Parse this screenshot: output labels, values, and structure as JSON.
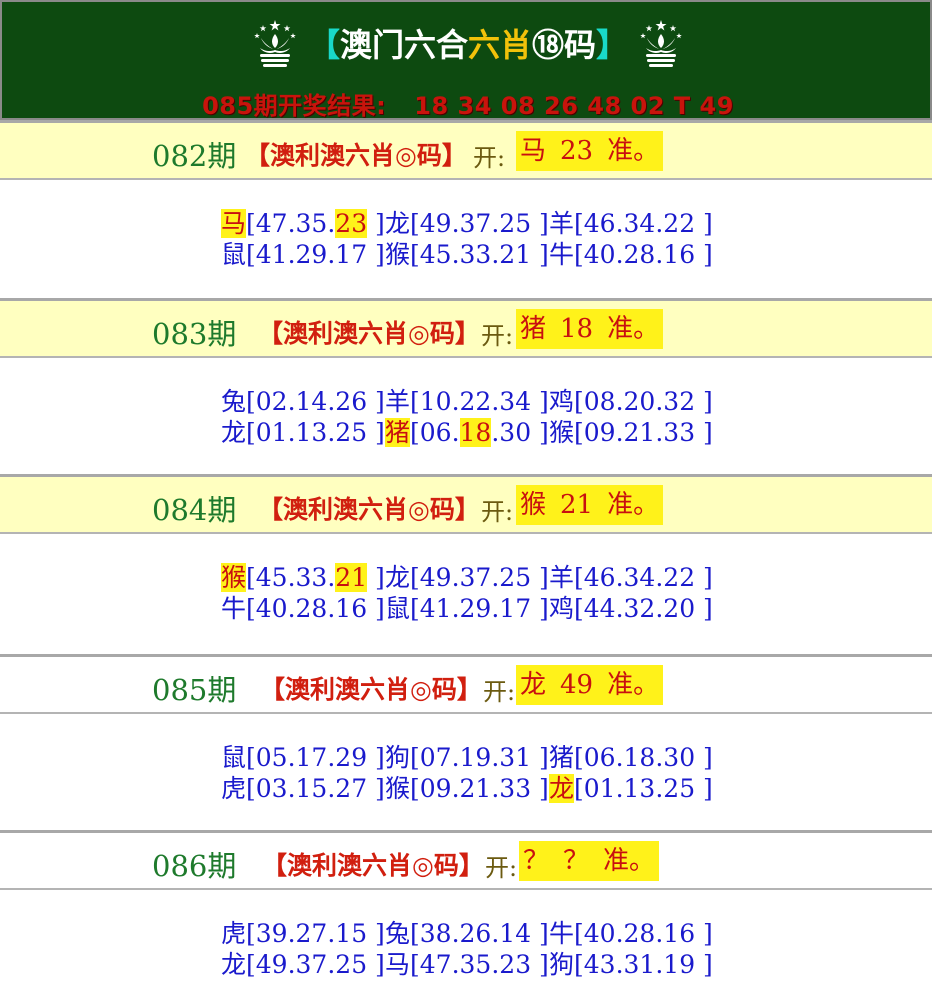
{
  "header": {
    "title_left_bracket": "【",
    "title_main": "澳门六合",
    "title_gold": "六肖",
    "title_circled": "⑱",
    "title_code": "码",
    "title_right_bracket": "】",
    "result_label": "085期开奖结果:",
    "result_numbers": "18 34 08 26 48 02 T 49"
  },
  "periods": [
    {
      "label": "082期",
      "title": "【澳利澳六肖◎码】",
      "open": "开:",
      "answer_zodiac": "马",
      "answer_number": "23",
      "answer_suffix": "准。",
      "rows": [
        [
          {
            "z": "马",
            "n1": "[47.35.",
            "hn": "23",
            "n2": " ]",
            "hz": true
          },
          {
            "z": "龙",
            "n1": "[49.37.25 ]"
          },
          {
            "z": "羊",
            "n1": "[46.34.22 ]"
          }
        ],
        [
          {
            "z": "鼠",
            "n1": "[41.29.17 ]"
          },
          {
            "z": "猴",
            "n1": "[45.33.21 ]"
          },
          {
            "z": "牛",
            "n1": "[40.28.16 ]"
          }
        ]
      ]
    },
    {
      "label": "083期",
      "title": "【澳利澳六肖◎码】",
      "open": "开:",
      "answer_zodiac": "猪",
      "answer_number": "18",
      "answer_suffix": "准。",
      "rows": [
        [
          {
            "z": "兔",
            "n1": "[02.14.26 ]"
          },
          {
            "z": "羊",
            "n1": "[10.22.34 ]"
          },
          {
            "z": "鸡",
            "n1": "[08.20.32 ]"
          }
        ],
        [
          {
            "z": "龙",
            "n1": "[01.13.25 ]"
          },
          {
            "z": "猪",
            "n1": "[06.",
            "hn": "18",
            "n2": ".30 ]",
            "hz": true
          },
          {
            "z": "猴",
            "n1": "[09.21.33 ]"
          }
        ]
      ]
    },
    {
      "label": "084期",
      "title": "【澳利澳六肖◎码】",
      "open": "开:",
      "answer_zodiac": "猴",
      "answer_number": "21",
      "answer_suffix": "准。",
      "rows": [
        [
          {
            "z": "猴",
            "n1": "[45.33.",
            "hn": "21",
            "n2": " ]",
            "hz": true
          },
          {
            "z": "龙",
            "n1": "[49.37.25 ]"
          },
          {
            "z": "羊",
            "n1": "[46.34.22 ]"
          }
        ],
        [
          {
            "z": "牛",
            "n1": "[40.28.16 ]"
          },
          {
            "z": "鼠",
            "n1": "[41.29.17 ]"
          },
          {
            "z": "鸡",
            "n1": "[44.32.20 ]"
          }
        ]
      ]
    },
    {
      "label": "085期",
      "title": "【澳利澳六肖◎码】",
      "open": "开:",
      "answer_zodiac": "龙",
      "answer_number": "49",
      "answer_suffix": "准。",
      "rows": [
        [
          {
            "z": "鼠",
            "n1": "[05.17.29 ]"
          },
          {
            "z": "狗",
            "n1": "[07.19.31 ]"
          },
          {
            "z": "猪",
            "n1": "[06.18.30 ]"
          }
        ],
        [
          {
            "z": "虎",
            "n1": "[03.15.27 ]"
          },
          {
            "z": "猴",
            "n1": "[09.21.33 ]"
          },
          {
            "z": "龙",
            "n1": "[01.13.25 ]",
            "hz": true
          }
        ]
      ]
    },
    {
      "label": "086期",
      "title": "【澳利澳六肖◎码】",
      "open": "开:",
      "answer_zodiac": "？",
      "answer_number": "？",
      "answer_suffix": "准。",
      "rows": [
        [
          {
            "z": "虎",
            "n1": "[39.27.15 ]"
          },
          {
            "z": "兔",
            "n1": "[38.26.14 ]"
          },
          {
            "z": "牛",
            "n1": "[40.28.16 ]"
          }
        ],
        [
          {
            "z": "龙",
            "n1": "[49.37.25 ]"
          },
          {
            "z": "马",
            "n1": "[47.35.23 ]"
          },
          {
            "z": "狗",
            "n1": "[43.31.19 ]"
          }
        ]
      ]
    }
  ],
  "colors": {
    "header_bg": "#0d4a10",
    "period_head_bg": "#ffffc0",
    "highlight": "#fff21a",
    "zodiac_blue": "#1a1acc",
    "title_red": "#d11f0f",
    "period_green": "#1e7a2c"
  },
  "icons": [
    "macau-emblem-icon"
  ]
}
